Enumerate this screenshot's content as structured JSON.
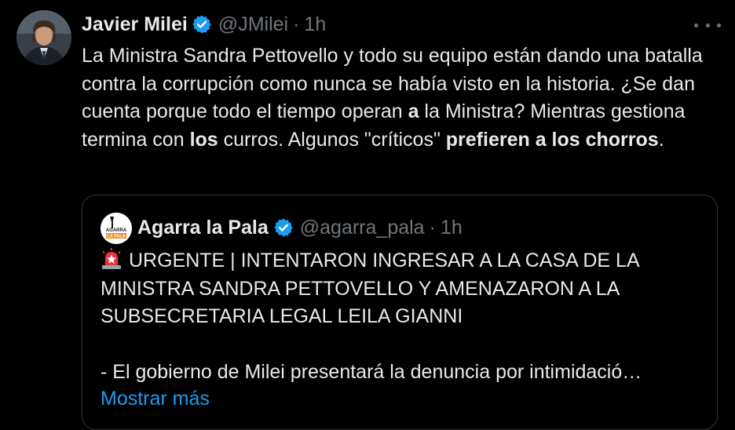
{
  "tweet": {
    "author_name": "Javier Milei",
    "author_handle": "@JMilei",
    "separator": "·",
    "time": "1h",
    "text": {
      "p1": "La Ministra Sandra Pettovello y todo su equipo están dando una batalla contra la corrupción como nunca se había visto en la historia. ¿Se dan cuenta porque todo el tiempo operan ",
      "b1": "a",
      "p2": " la Ministra? Mientras gestiona termina con ",
      "b2": "los",
      "p3": " curros. Algunos \"críticos\" ",
      "b3": "prefieren a los chorros",
      "p4": "."
    }
  },
  "quote": {
    "author_name": "Agarra la Pala",
    "author_handle": "@agarra_pala",
    "separator": "·",
    "time": "1h",
    "avatar_text_top": "AGARRA",
    "avatar_text_bottom": "LA PALA",
    "headline": "URGENTE | INTENTARON INGRESAR A LA CASA DE LA MINISTRA SANDRA PETTOVELLO Y AMENAZARON A LA SUBSECRETARIA LEGAL LEILA GIANNI",
    "line2": "- El gobierno de Milei presentará la denuncia por intimidació…",
    "show_more": "Mostrar más"
  },
  "icons": {
    "verified": "verified-badge-icon",
    "more": "more-options-icon",
    "siren": "rotating-light-icon"
  },
  "colors": {
    "background": "#000000",
    "text": "#e7e9ea",
    "secondary": "#71767b",
    "accent": "#1d9bf0",
    "border": "#2f3336"
  }
}
